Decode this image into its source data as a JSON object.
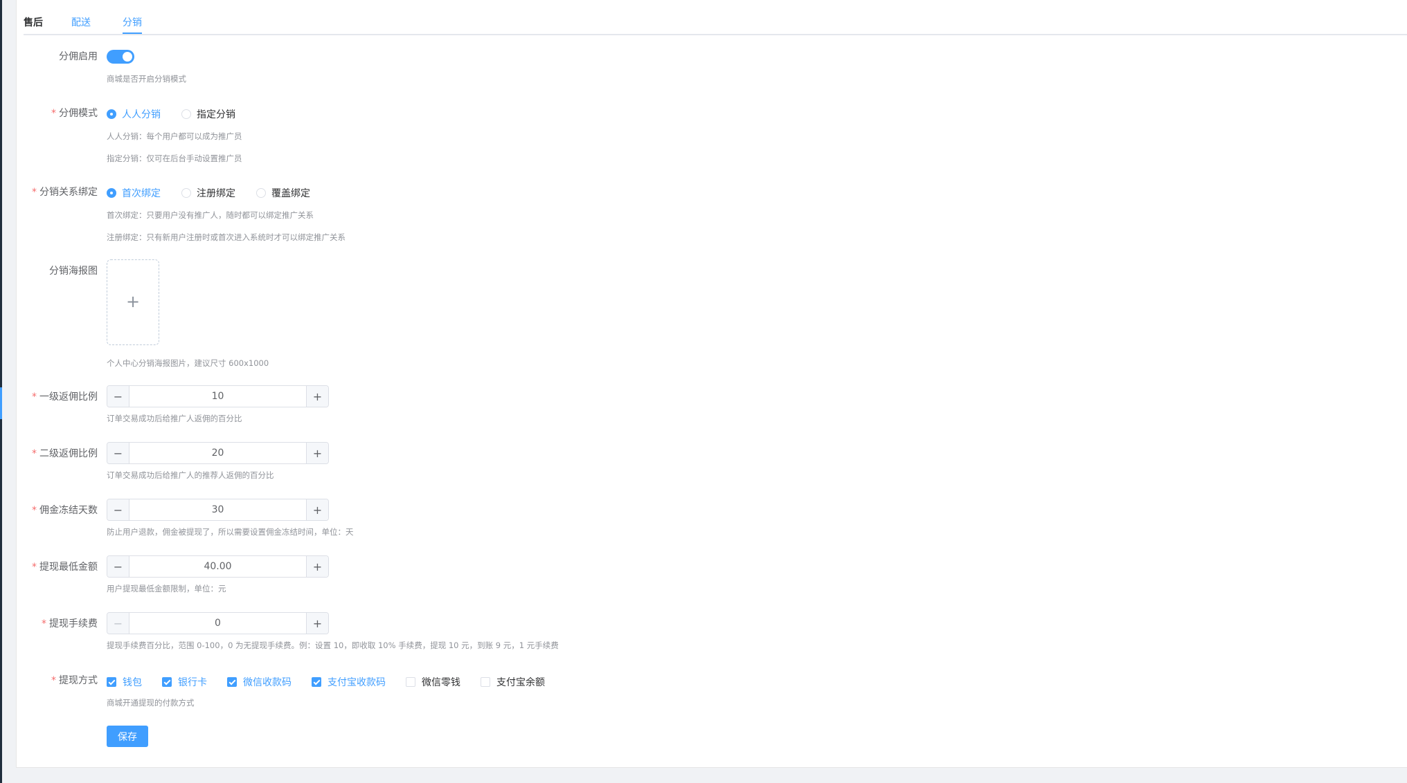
{
  "tabs": [
    "售后",
    "配送",
    "分销"
  ],
  "commission_enabled": {
    "label": "分佣启用",
    "on": true,
    "hint": "商城是否开启分销模式"
  },
  "commission_mode": {
    "label": "分佣模式",
    "options": [
      "人人分销",
      "指定分销"
    ],
    "selected": "人人分销",
    "hints": [
      "人人分销：每个用户都可以成为推广员",
      "指定分销：仅可在后台手动设置推广员"
    ]
  },
  "binding": {
    "label": "分销关系绑定",
    "options": [
      "首次绑定",
      "注册绑定",
      "覆盖绑定"
    ],
    "selected": "首次绑定",
    "hints": [
      "首次绑定：只要用户没有推广人，随时都可以绑定推广关系",
      "注册绑定：只有新用户注册时或首次进入系统时才可以绑定推广关系"
    ]
  },
  "poster": {
    "label": "分销海报图",
    "plus": "+",
    "hint": "个人中心分销海报图片，建议尺寸 600x1000"
  },
  "level1": {
    "label": "一级返佣比例",
    "value": "10",
    "hint": "订单交易成功后给推广人返佣的百分比"
  },
  "level2": {
    "label": "二级返佣比例",
    "value": "20",
    "hint": "订单交易成功后给推广人的推荐人返佣的百分比"
  },
  "freeze_days": {
    "label": "佣金冻结天数",
    "value": "30",
    "hint": "防止用户退款，佣金被提现了，所以需要设置佣金冻结时间，单位：天"
  },
  "min_withdraw": {
    "label": "提现最低金额",
    "value": "40.00",
    "hint": "用户提现最低金额限制，单位：元"
  },
  "withdraw_fee": {
    "label": "提现手续费",
    "value": "0",
    "hint": "提现手续费百分比，范围 0-100，0 为无提现手续费。例：设置 10，即收取 10% 手续费，提现 10 元，到账 9 元，1 元手续费"
  },
  "withdraw_methods": {
    "label": "提现方式",
    "options": [
      {
        "label": "钱包",
        "checked": true
      },
      {
        "label": "银行卡",
        "checked": true
      },
      {
        "label": "微信收款码",
        "checked": true
      },
      {
        "label": "支付宝收款码",
        "checked": true
      },
      {
        "label": "微信零钱",
        "checked": false
      },
      {
        "label": "支付宝余额",
        "checked": false
      }
    ],
    "hint": "商城开通提现的付款方式"
  },
  "stepper": {
    "minus": "−",
    "plus": "+"
  },
  "save_label": "保存",
  "colors": {
    "primary": "#409eff",
    "required": "#f56c6c",
    "hint": "#909399",
    "border": "#dcdfe6"
  }
}
